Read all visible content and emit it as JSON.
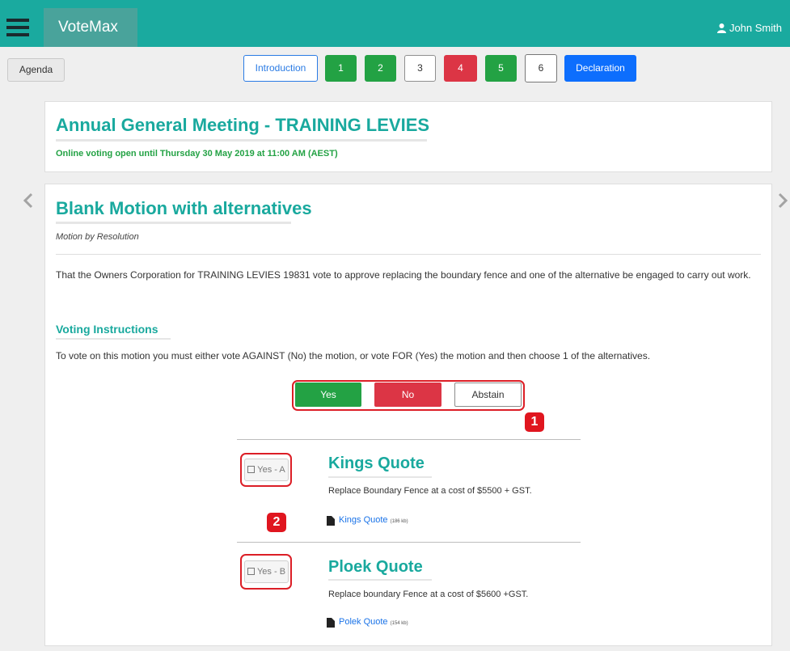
{
  "header": {
    "brand": "VoteMax",
    "user": "John Smith"
  },
  "toolbar": {
    "agenda": "Agenda",
    "items": [
      {
        "label": "Introduction"
      },
      {
        "label": "1"
      },
      {
        "label": "2"
      },
      {
        "label": "3"
      },
      {
        "label": "4"
      },
      {
        "label": "5"
      },
      {
        "label": "6"
      },
      {
        "label": "Declaration"
      }
    ]
  },
  "meeting": {
    "title": "Annual General Meeting - TRAINING LEVIES",
    "status": "Online voting open until Thursday 30 May 2019 at 11:00 AM (AEST)"
  },
  "motion": {
    "title": "Blank Motion with alternatives",
    "subtitle": "Motion by Resolution",
    "text": "That the Owners Corporation for TRAINING LEVIES 19831 vote to approve replacing the boundary fence and one of the alternative be engaged to carry out work.",
    "instructions_heading": "Voting Instructions",
    "instructions": "To vote on this motion you must either vote AGAINST (No) the motion, or vote FOR (Yes) the motion and then choose 1 of the alternatives.",
    "vote": {
      "yes": "Yes",
      "no": "No",
      "abstain": "Abstain"
    }
  },
  "badges": [
    "1",
    "2"
  ],
  "alternatives": [
    {
      "button": "Yes - A",
      "title": "Kings Quote",
      "description": "Replace Boundary Fence at a cost of $5500 + GST.",
      "doc_name": "Kings Quote",
      "doc_size": "(186 kb)"
    },
    {
      "button": "Yes - B",
      "title": "Ploek Quote",
      "description": "Replace boundary Fence at a cost of $5600 +GST.",
      "doc_name": "Polek Quote",
      "doc_size": "(154 kb)"
    }
  ],
  "colors": {
    "teal": "#1aaa9f",
    "green": "#23a244",
    "red": "#dc3545",
    "blue": "#0d6efd"
  }
}
